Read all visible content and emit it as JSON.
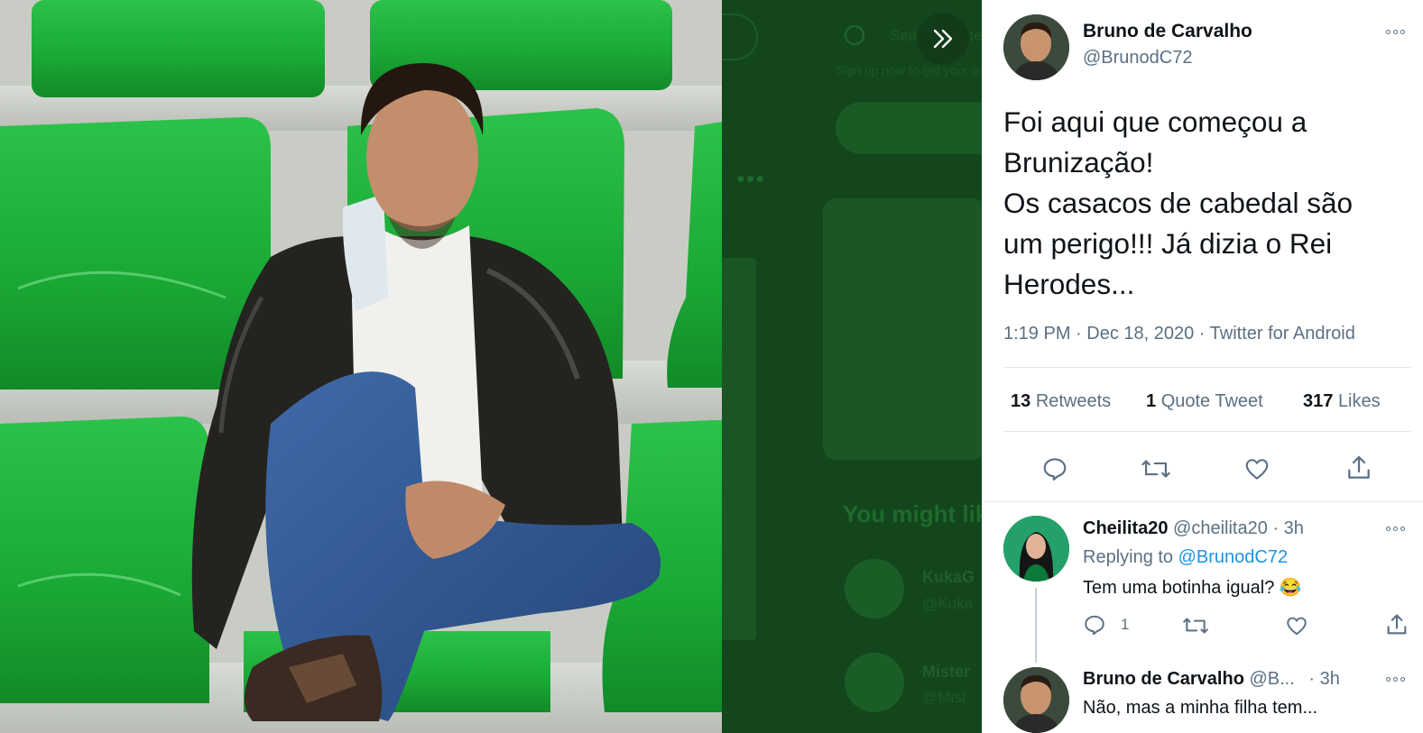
{
  "backdrop": {
    "search_placeholder": "Search Twitter",
    "banner_text": "Sign up now to get your own personalized timeline!",
    "section_title": "You might like",
    "suggestions": [
      {
        "name": "KukaG",
        "handle": "@Kuka"
      },
      {
        "name": "Mister",
        "handle": "@Mist"
      }
    ]
  },
  "tweet": {
    "author_name": "Bruno de Carvalho",
    "author_handle": "@BrunodC72",
    "text_lines": [
      "Foi aqui que começou a",
      "Brunização!",
      "Os casacos de cabedal são",
      "um perigo!!! Já dizia o Rei",
      "Herodes..."
    ],
    "meta": "1:19 PM · Dec 18, 2020 · Twitter for Android",
    "stats": {
      "retweets_count": "13",
      "retweets_label": "Retweets",
      "quotes_count": "1",
      "quotes_label": "Quote Tweet",
      "likes_count": "317",
      "likes_label": "Likes"
    },
    "icons": [
      "reply-icon",
      "retweet-icon",
      "like-icon",
      "share-icon"
    ]
  },
  "replies": [
    {
      "author_name": "Cheilita20",
      "author_handle": "@cheilita20",
      "time": "· 3h",
      "replying_prefix": "Replying to",
      "replying_to": "@BrunodC72",
      "text": "Tem uma botinha igual? 😂",
      "reply_count": "1"
    },
    {
      "author_name": "Bruno de Carvalho",
      "author_handle": "@B...",
      "time": "· 3h",
      "text": "Não, mas a minha filha tem..."
    }
  ],
  "colors": {
    "accent": "#1b95e0",
    "muted_text": "#5b7083",
    "seat_green": "#1fae3a",
    "backdrop_green": "#14461e"
  }
}
